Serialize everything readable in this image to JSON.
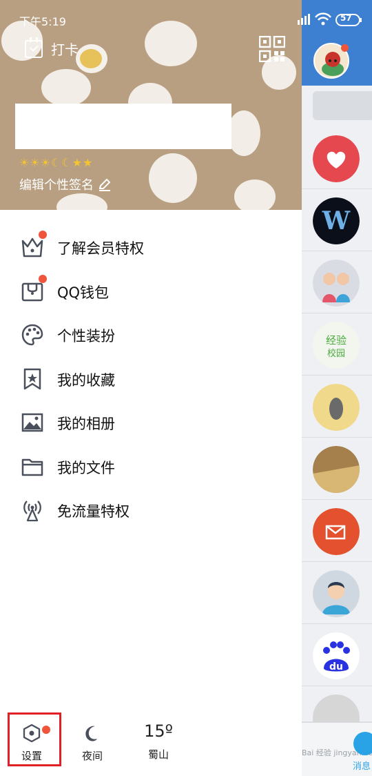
{
  "status_bar": {
    "time": "下午5:19",
    "battery": "57"
  },
  "header": {
    "checkin_label": "打卡",
    "level_icons": [
      "sun-icon",
      "sun-icon",
      "sun-icon",
      "moon-icon",
      "moon-icon",
      "star-icon",
      "star-icon"
    ],
    "signature_label": "编辑个性签名"
  },
  "menu": [
    {
      "label": "了解会员特权",
      "icon": "crown-icon",
      "badge": true
    },
    {
      "label": "QQ钱包",
      "icon": "wallet-icon",
      "badge": true
    },
    {
      "label": "个性装扮",
      "icon": "palette-icon",
      "badge": false
    },
    {
      "label": "我的收藏",
      "icon": "bookmark-star-icon",
      "badge": false
    },
    {
      "label": "我的相册",
      "icon": "photo-icon",
      "badge": false
    },
    {
      "label": "我的文件",
      "icon": "folder-icon",
      "badge": false
    },
    {
      "label": "免流量特权",
      "icon": "antenna-icon",
      "badge": false
    }
  ],
  "bottom": {
    "settings_label": "设置",
    "night_label": "夜间",
    "temperature": "15º",
    "city": "蜀山"
  },
  "right_panel": {
    "messages_label": "消息",
    "watermark": "Bai 经验 jingyan.baidu.com"
  },
  "colors": {
    "header_bg": "#b89f82",
    "badge": "#f0553c",
    "highlight_box": "#e21f26",
    "title_bar_blue": "#3d7fd0"
  }
}
